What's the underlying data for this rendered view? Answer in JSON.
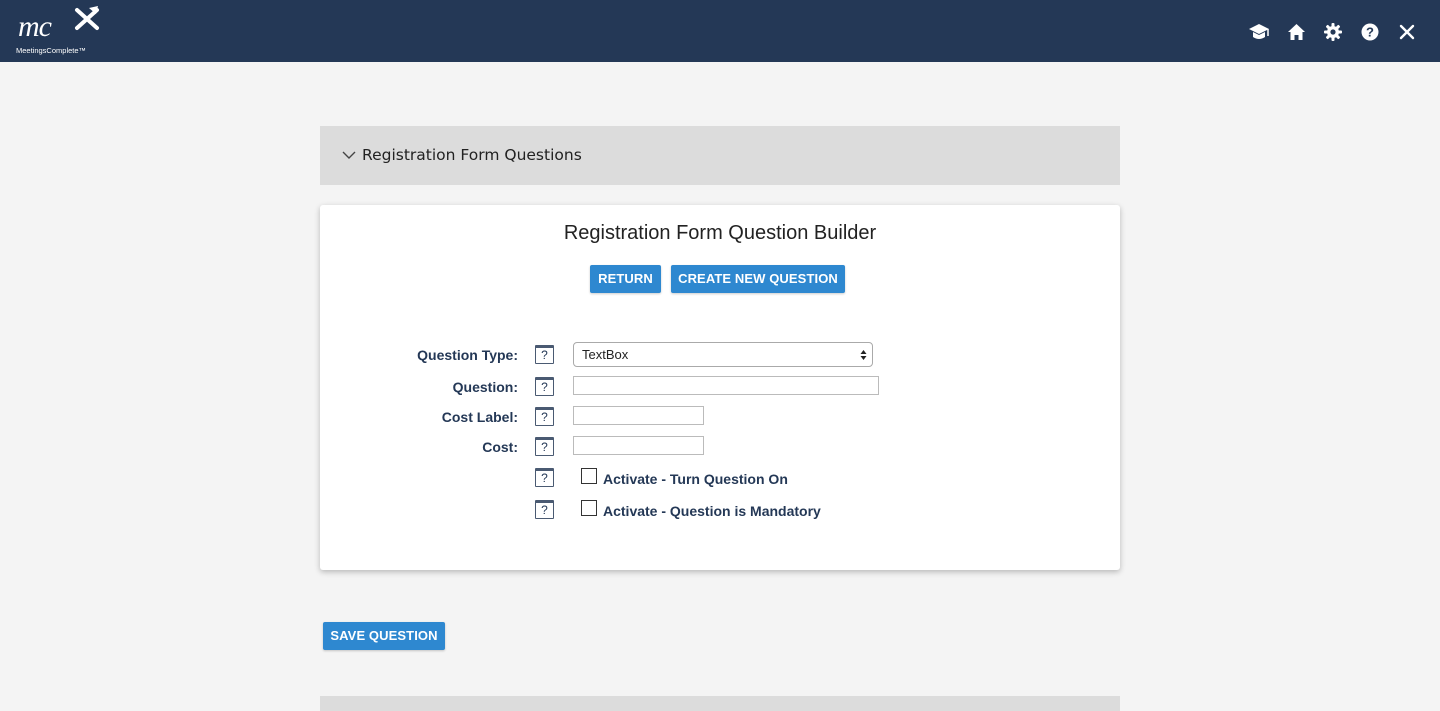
{
  "brand": {
    "logo_mark": "mc",
    "logo_name": "MeetingsComplete™"
  },
  "topbar_icons": [
    "graduation-cap-icon",
    "home-icon",
    "gear-icon",
    "help-icon",
    "close-icon"
  ],
  "section": {
    "title": "Registration Form Questions",
    "expanded": true
  },
  "card": {
    "title": "Registration Form Question Builder",
    "return_label": "RETURN",
    "create_label": "CREATE NEW QUESTION"
  },
  "form": {
    "help_glyph": "?",
    "question_type": {
      "label": "Question Type:",
      "value": "TextBox"
    },
    "question": {
      "label": "Question:",
      "value": ""
    },
    "cost_label": {
      "label": "Cost Label:",
      "value": ""
    },
    "cost": {
      "label": "Cost:",
      "value": ""
    },
    "activate_on": {
      "label": "Activate - Turn Question On",
      "checked": false
    },
    "mandatory": {
      "label": "Activate - Question is Mandatory",
      "checked": false
    }
  },
  "save_label": "SAVE QUESTION",
  "colors": {
    "topbar": "#243856",
    "button": "#2e88d0",
    "label": "#243856",
    "background": "#f4f4f4",
    "header_panel": "#dcdcdc"
  }
}
